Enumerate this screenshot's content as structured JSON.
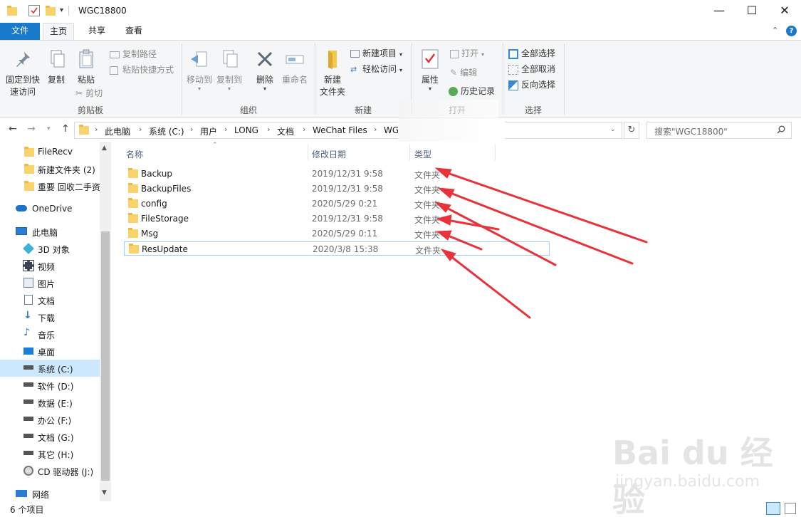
{
  "window": {
    "title": "WGC18800",
    "controls": {
      "minimize": "—",
      "maximize": "☐",
      "close": "✕"
    }
  },
  "tabs": {
    "file": "文件",
    "home": "主页",
    "share": "共享",
    "view": "查看"
  },
  "ribbon": {
    "clipboard": {
      "pin": [
        "固定到快",
        "速访问"
      ],
      "copy": "复制",
      "paste": "粘贴",
      "copy_path": "复制路径",
      "paste_shortcut": "粘贴快捷方式",
      "cut": "剪切",
      "label": "剪贴板"
    },
    "organize": {
      "move_to": "移动到",
      "copy_to": "复制到",
      "delete": "删除",
      "rename": "重命名",
      "label": "组织"
    },
    "new": {
      "new_folder": [
        "新建",
        "文件夹"
      ],
      "new_item": "新建项目",
      "easy_access": "轻松访问",
      "label": "新建"
    },
    "open": {
      "properties": "属性",
      "open": "打开",
      "edit": "编辑",
      "history": "历史记录",
      "label": "打开"
    },
    "select": {
      "select_all": "全部选择",
      "select_none": "全部取消",
      "invert": "反向选择",
      "label": "选择"
    }
  },
  "address": {
    "crumbs": [
      "此电脑",
      "系统 (C:)",
      "用户",
      "LONG",
      "文档",
      "WeChat Files",
      "WG"
    ],
    "search_placeholder": "搜索\"WGC18800\""
  },
  "sidebar": {
    "items": [
      {
        "label": "FileRecv",
        "icon": "folder-icon"
      },
      {
        "label": "新建文件夹 (2)",
        "icon": "folder-icon"
      },
      {
        "label": "重要 回收二手资",
        "icon": "folder-icon"
      },
      {
        "label": "OneDrive",
        "icon": "cloud-icon"
      },
      {
        "label": "此电脑",
        "icon": "computer-icon"
      },
      {
        "label": "3D 对象",
        "icon": "cube-icon"
      },
      {
        "label": "视频",
        "icon": "video-icon"
      },
      {
        "label": "图片",
        "icon": "picture-icon"
      },
      {
        "label": "文档",
        "icon": "document-icon"
      },
      {
        "label": "下载",
        "icon": "download-icon"
      },
      {
        "label": "音乐",
        "icon": "music-icon"
      },
      {
        "label": "桌面",
        "icon": "desktop-icon"
      },
      {
        "label": "系统 (C:)",
        "icon": "drive-icon"
      },
      {
        "label": "软件 (D:)",
        "icon": "drive-icon"
      },
      {
        "label": "数据 (E:)",
        "icon": "drive-icon"
      },
      {
        "label": "办公 (F:)",
        "icon": "drive-icon"
      },
      {
        "label": "文档 (G:)",
        "icon": "drive-icon"
      },
      {
        "label": "其它 (H:)",
        "icon": "drive-icon"
      },
      {
        "label": "CD 驱动器 (J:)",
        "icon": "cd-drive-icon"
      },
      {
        "label": "网络",
        "icon": "network-icon"
      }
    ],
    "selected": "系统 (C:)"
  },
  "columns": {
    "name": "名称",
    "modified": "修改日期",
    "type": "类型"
  },
  "files": [
    {
      "name": "Backup",
      "modified": "2019/12/31 9:58",
      "type": "文件夹"
    },
    {
      "name": "BackupFiles",
      "modified": "2019/12/31 9:58",
      "type": "文件夹"
    },
    {
      "name": "config",
      "modified": "2020/5/29 0:21",
      "type": "文件夹"
    },
    {
      "name": "FileStorage",
      "modified": "2019/12/31 9:58",
      "type": "文件夹"
    },
    {
      "name": "Msg",
      "modified": "2020/5/29 0:11",
      "type": "文件夹"
    },
    {
      "name": "ResUpdate",
      "modified": "2020/3/8 15:38",
      "type": "文件夹"
    }
  ],
  "status": {
    "count": "6 个项目"
  },
  "watermark": {
    "brand": "Bai du 经验",
    "url": "jingyan.baidu.com"
  },
  "colors": {
    "accent": "#1979ca",
    "selection": "#cce8ff",
    "arrow": "#e8333a"
  }
}
